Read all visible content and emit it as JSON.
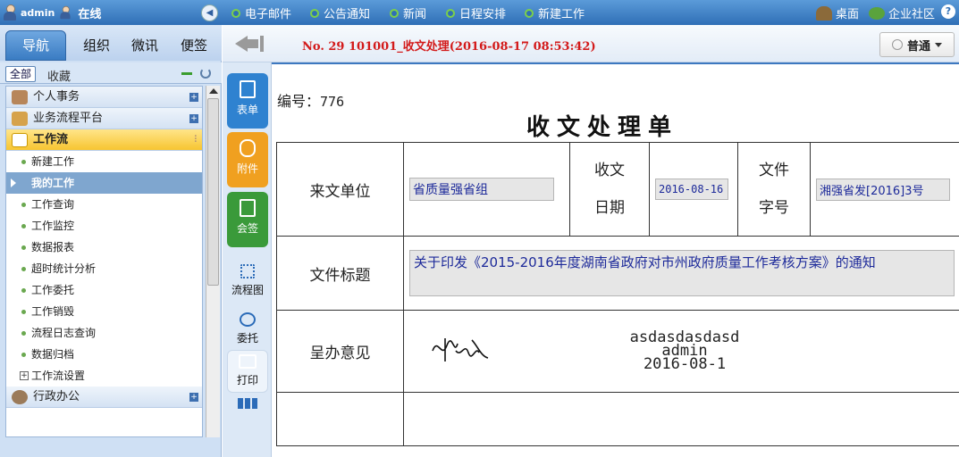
{
  "topbar": {
    "user": "admin",
    "status": "在线",
    "links": [
      "电子邮件",
      "公告通知",
      "新闻",
      "日程安排",
      "新建工作"
    ],
    "right": {
      "desktop": "桌面",
      "community": "企业社区"
    }
  },
  "sidebar": {
    "tabs": [
      "导航",
      "组织",
      "微讯",
      "便签"
    ],
    "filter_all": "全部",
    "favorites": "收藏",
    "groups": {
      "personal": "个人事务",
      "bpm": "业务流程平台",
      "workflow": "工作流",
      "admin_office": "行政办公"
    },
    "workflow_items": [
      "新建工作",
      "我的工作",
      "工作查询",
      "工作监控",
      "数据报表",
      "超时统计分析",
      "工作委托",
      "工作销毁",
      "流程日志查询",
      "数据归档",
      "工作流设置"
    ]
  },
  "toolbar": {
    "doc_title": "No. 29 101001_收文处理(2016-08-17 08:53:42)",
    "mode": "普通"
  },
  "actions": [
    "表单",
    "附件",
    "会签",
    "流程图",
    "委托",
    "打印"
  ],
  "form": {
    "number_label": "编号：",
    "number_value": "776",
    "title": "收文处理单",
    "labels": {
      "from_unit": "来文单位",
      "recv_date_1": "收文",
      "recv_date_2": "日期",
      "doc_no_1": "文件",
      "doc_no_2": "字号",
      "file_title": "文件标题",
      "opinion": "呈办意见"
    },
    "values": {
      "from_unit": "省质量强省组",
      "recv_date": "2016-08-16",
      "doc_no": "湘强省发[2016]3号",
      "file_title": "关于印发《2015-2016年度湖南省政府对市州政府质量工作考核方案》的通知",
      "opinion_line1": "asdasdasdasd",
      "opinion_line2": "admin",
      "opinion_line3": "2016-08-1"
    }
  },
  "colors": {
    "topbar": "#2f6fb6",
    "doc_title": "#d31a1a",
    "field_text": "#1d2a9a",
    "act_form": "#2f82d0",
    "act_attach": "#f0a020",
    "act_sign": "#3a9a3a"
  }
}
